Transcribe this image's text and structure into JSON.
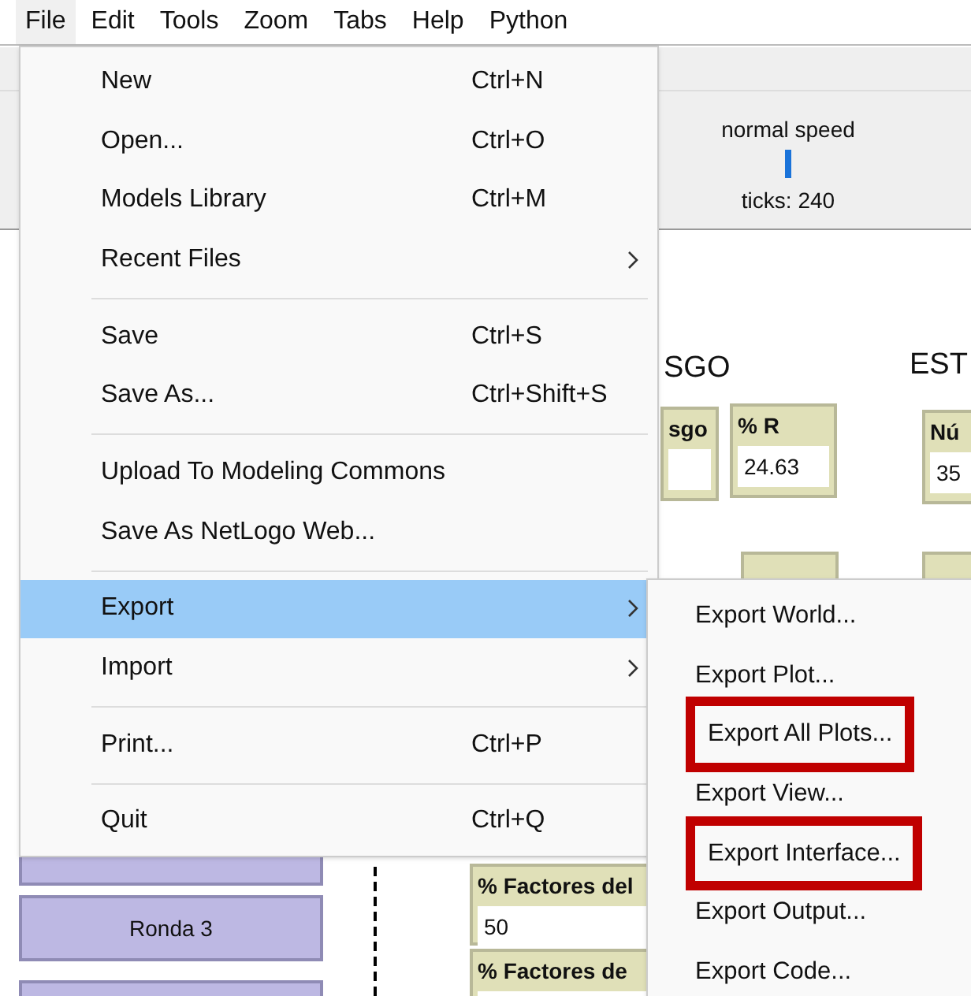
{
  "menubar": [
    {
      "label": "File",
      "selected": true
    },
    {
      "label": "Edit",
      "selected": false
    },
    {
      "label": "Tools",
      "selected": false
    },
    {
      "label": "Zoom",
      "selected": false
    },
    {
      "label": "Tabs",
      "selected": false
    },
    {
      "label": "Help",
      "selected": false
    },
    {
      "label": "Python",
      "selected": false
    }
  ],
  "toolbar": {
    "speed_label": "normal speed",
    "ticks": "ticks: 240"
  },
  "interface": {
    "headings": [
      "SGO",
      "EST"
    ],
    "monitors": [
      {
        "label": "sgo"
      },
      {
        "label": "% R",
        "value": "24.63"
      },
      {
        "label": "Nú",
        "value": "35"
      },
      {
        "label": "% Factores del",
        "value": "50"
      },
      {
        "label": "% Factores de"
      }
    ],
    "buttons": [
      {
        "label": "Ronda 3"
      }
    ]
  },
  "file_menu": {
    "items": [
      {
        "kind": "item",
        "label": "New",
        "shortcut": "Ctrl+N",
        "selected": false
      },
      {
        "kind": "item",
        "label": "Open...",
        "shortcut": "Ctrl+O",
        "selected": false
      },
      {
        "kind": "item",
        "label": "Models Library",
        "shortcut": "Ctrl+M",
        "selected": false
      },
      {
        "kind": "submenu",
        "label": "Recent Files",
        "selected": false
      },
      {
        "kind": "separator"
      },
      {
        "kind": "item",
        "label": "Save",
        "shortcut": "Ctrl+S",
        "selected": false
      },
      {
        "kind": "item",
        "label": "Save As...",
        "shortcut": "Ctrl+Shift+S",
        "selected": false
      },
      {
        "kind": "separator"
      },
      {
        "kind": "item",
        "label": "Upload To Modeling Commons",
        "selected": false
      },
      {
        "kind": "item",
        "label": "Save As NetLogo Web...",
        "selected": false
      },
      {
        "kind": "separator"
      },
      {
        "kind": "submenu",
        "label": "Export",
        "selected": true
      },
      {
        "kind": "submenu",
        "label": "Import",
        "selected": false
      },
      {
        "kind": "separator"
      },
      {
        "kind": "item",
        "label": "Print...",
        "shortcut": "Ctrl+P",
        "selected": false
      },
      {
        "kind": "separator"
      },
      {
        "kind": "item",
        "label": "Quit",
        "shortcut": "Ctrl+Q",
        "selected": false
      }
    ]
  },
  "export_menu": {
    "items": [
      {
        "label": "Export World...",
        "highlighted": false
      },
      {
        "label": "Export Plot...",
        "highlighted": false
      },
      {
        "label": "Export All Plots...",
        "highlighted": true
      },
      {
        "label": "Export View...",
        "highlighted": false
      },
      {
        "label": "Export Interface...",
        "highlighted": true
      },
      {
        "label": "Export Output...",
        "highlighted": false
      },
      {
        "label": "Export Code...",
        "highlighted": false
      }
    ]
  }
}
